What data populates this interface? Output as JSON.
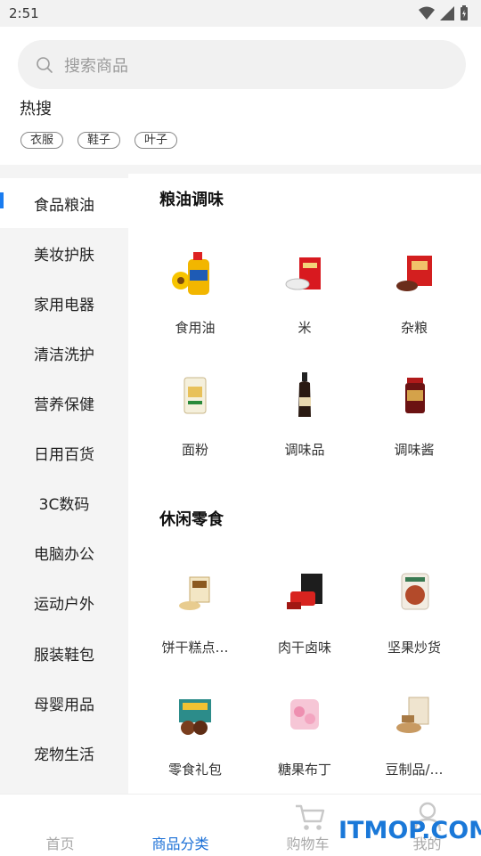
{
  "status_bar": {
    "time": "2:51",
    "icons": [
      "wifi-icon",
      "signal-icon",
      "battery-icon"
    ]
  },
  "search": {
    "placeholder": "搜索商品",
    "icon": "search-icon"
  },
  "hot_search": {
    "title": "热搜",
    "tags": [
      "衣服",
      "鞋子",
      "叶子"
    ]
  },
  "sidebar": {
    "active_index": 0,
    "items": [
      "食品粮油",
      "美妆护肤",
      "家用电器",
      "清洁洗护",
      "营养保健",
      "日用百货",
      "3C数码",
      "电脑办公",
      "运动户外",
      "服装鞋包",
      "母婴用品",
      "宠物生活"
    ]
  },
  "sections": [
    {
      "title": "粮油调味",
      "items": [
        {
          "label": "食用油",
          "icon": "oil-bottle-icon"
        },
        {
          "label": "米",
          "icon": "rice-bag-icon"
        },
        {
          "label": "杂粮",
          "icon": "grain-box-icon"
        },
        {
          "label": "面粉",
          "icon": "flour-bag-icon"
        },
        {
          "label": "调味品",
          "icon": "soy-sauce-bottle-icon"
        },
        {
          "label": "调味酱",
          "icon": "sauce-jar-icon"
        }
      ]
    },
    {
      "title": "休闲零食",
      "items": [
        {
          "label": "饼干糕点…",
          "icon": "biscuit-icon"
        },
        {
          "label": "肉干卤味",
          "icon": "jerky-icon"
        },
        {
          "label": "坚果炒货",
          "icon": "nuts-bag-icon"
        },
        {
          "label": "零食礼包",
          "icon": "snack-gift-box-icon"
        },
        {
          "label": "糖果布丁",
          "icon": "candy-icon"
        },
        {
          "label": "豆制品/…",
          "icon": "tofu-snack-icon"
        }
      ]
    }
  ],
  "tabbar": {
    "active_index": 1,
    "tabs": [
      {
        "label": "首页",
        "icon": "home-icon"
      },
      {
        "label": "商品分类",
        "icon": "category-icon"
      },
      {
        "label": "购物车",
        "icon": "cart-icon"
      },
      {
        "label": "我的",
        "icon": "user-icon"
      }
    ]
  },
  "watermark": "ITMOP.COM",
  "colors": {
    "accent": "#1a6fd6",
    "sidebar_bg": "#f4f4f4",
    "search_bg": "#f1f1f1"
  }
}
